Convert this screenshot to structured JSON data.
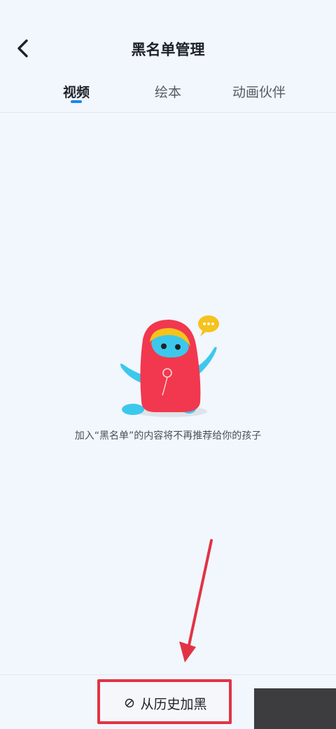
{
  "header": {
    "title": "黑名单管理",
    "back_icon": "chevron-left-icon"
  },
  "tabs": [
    {
      "label": "视频",
      "active": true
    },
    {
      "label": "绘本",
      "active": false
    },
    {
      "label": "动画伙伴",
      "active": false
    }
  ],
  "empty_state": {
    "illustration": "red-mascot-character",
    "text": "加入“黑名单”的内容将不再推荐给你的孩子"
  },
  "footer": {
    "button_label": "从历史加黑",
    "button_icon": "ban-icon"
  },
  "colors": {
    "background": "#f2f6fd",
    "accent": "#1f86e8",
    "highlight": "#e03444"
  }
}
